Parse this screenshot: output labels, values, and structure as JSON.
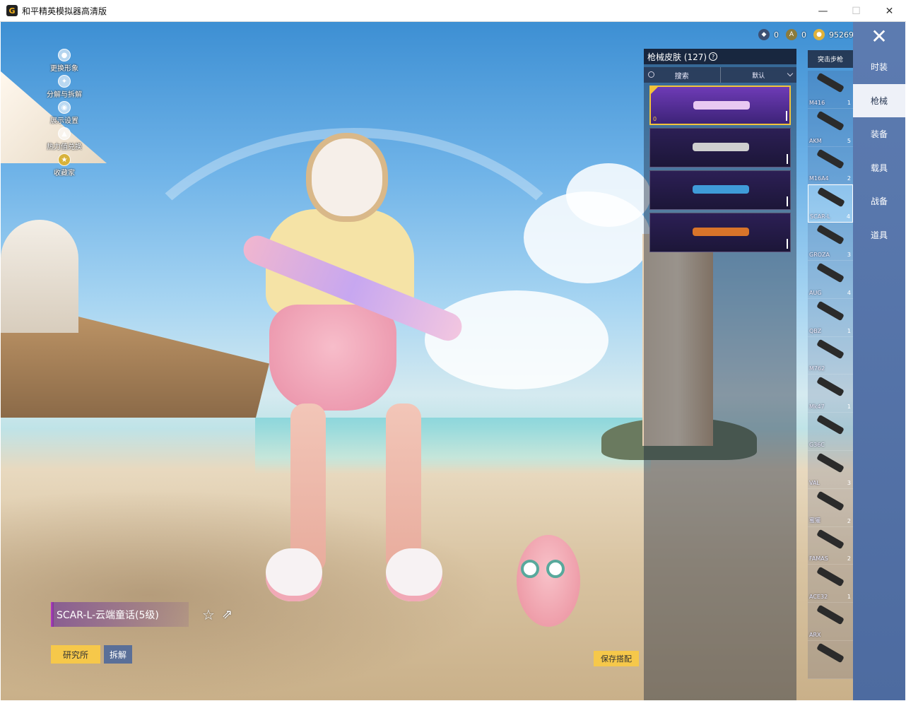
{
  "window": {
    "title": "和平精英模拟器高清版",
    "icon_label": "G",
    "controls": {
      "minimize": "—",
      "maximize": "☐",
      "close": "✕"
    }
  },
  "left_menu": [
    {
      "label": "更换形象",
      "icon": "person-icon"
    },
    {
      "label": "分解与拆解",
      "icon": "dismantle-icon"
    },
    {
      "label": "展示设置",
      "icon": "eye-icon"
    },
    {
      "label": "热力值兑换",
      "icon": "flame-icon"
    },
    {
      "label": "收藏家",
      "icon": "collector-badge-icon"
    }
  ],
  "currency": {
    "item1_value": "0",
    "item2_value": "0",
    "coins_value": "95269"
  },
  "close_label": "✕",
  "categories": [
    {
      "label": "时装",
      "active": false
    },
    {
      "label": "枪械",
      "active": true
    },
    {
      "label": "装备",
      "active": false
    },
    {
      "label": "载具",
      "active": false
    },
    {
      "label": "战备",
      "active": false
    },
    {
      "label": "道具",
      "active": false
    }
  ],
  "weapon_filter": "突击步枪",
  "weapons": [
    {
      "name": "M416",
      "count": "1",
      "selected": false
    },
    {
      "name": "AKM",
      "count": "5",
      "selected": false
    },
    {
      "name": "M16A4",
      "count": "2",
      "selected": false
    },
    {
      "name": "SCAR-L",
      "count": "4",
      "selected": true
    },
    {
      "name": "GROZA",
      "count": "3",
      "selected": false
    },
    {
      "name": "AUG",
      "count": "4",
      "selected": false
    },
    {
      "name": "QBZ",
      "count": "1",
      "selected": false
    },
    {
      "name": "M762",
      "count": "",
      "selected": false
    },
    {
      "name": "Mk47",
      "count": "1",
      "selected": false
    },
    {
      "name": "G36C",
      "count": "",
      "selected": false
    },
    {
      "name": "VAL",
      "count": "3",
      "selected": false
    },
    {
      "name": "蜜獾",
      "count": "2",
      "selected": false
    },
    {
      "name": "FAMAS",
      "count": "2",
      "selected": false
    },
    {
      "name": "ACE32",
      "count": "1",
      "selected": false
    },
    {
      "name": "ARX",
      "count": "",
      "selected": false
    },
    {
      "name": "",
      "count": "",
      "selected": false
    }
  ],
  "skin_panel": {
    "title": "枪械皮肤 (127)",
    "help": "?",
    "search_label": "搜索",
    "sort_label": "默认",
    "cards": [
      {
        "selected": true,
        "corner_num": "0",
        "gun_color": "#e8c9f2"
      },
      {
        "selected": false,
        "corner_num": "",
        "gun_color": "#cfcfcf"
      },
      {
        "selected": false,
        "corner_num": "",
        "gun_color": "#3f9bd8"
      },
      {
        "selected": false,
        "corner_num": "",
        "gun_color": "#d8742a"
      }
    ]
  },
  "skin_info": {
    "name": "SCAR-L-云端童话(5级)",
    "research_button": "研究所",
    "dismantle_button": "拆解",
    "save_button": "保存搭配"
  },
  "colors": {
    "accent_yellow": "#f6c84a",
    "panel_blue": "#5c7bb0",
    "selected_purple": "#6e3bb6"
  }
}
